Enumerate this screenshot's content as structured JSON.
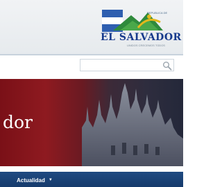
{
  "logo": {
    "small_text": "REPUBLICA DE",
    "name": "EL SALVADOR",
    "tagline": "UNIDOS CRECEMOS TODOS"
  },
  "search": {
    "value": "",
    "placeholder": ""
  },
  "banner": {
    "text": "dor"
  },
  "nav": {
    "item_label": "Actualidad",
    "caret": "▼"
  },
  "colors": {
    "brand_blue": "#163a8c",
    "nav_blue": "#1f4a82",
    "banner_red": "#8e1a20"
  }
}
